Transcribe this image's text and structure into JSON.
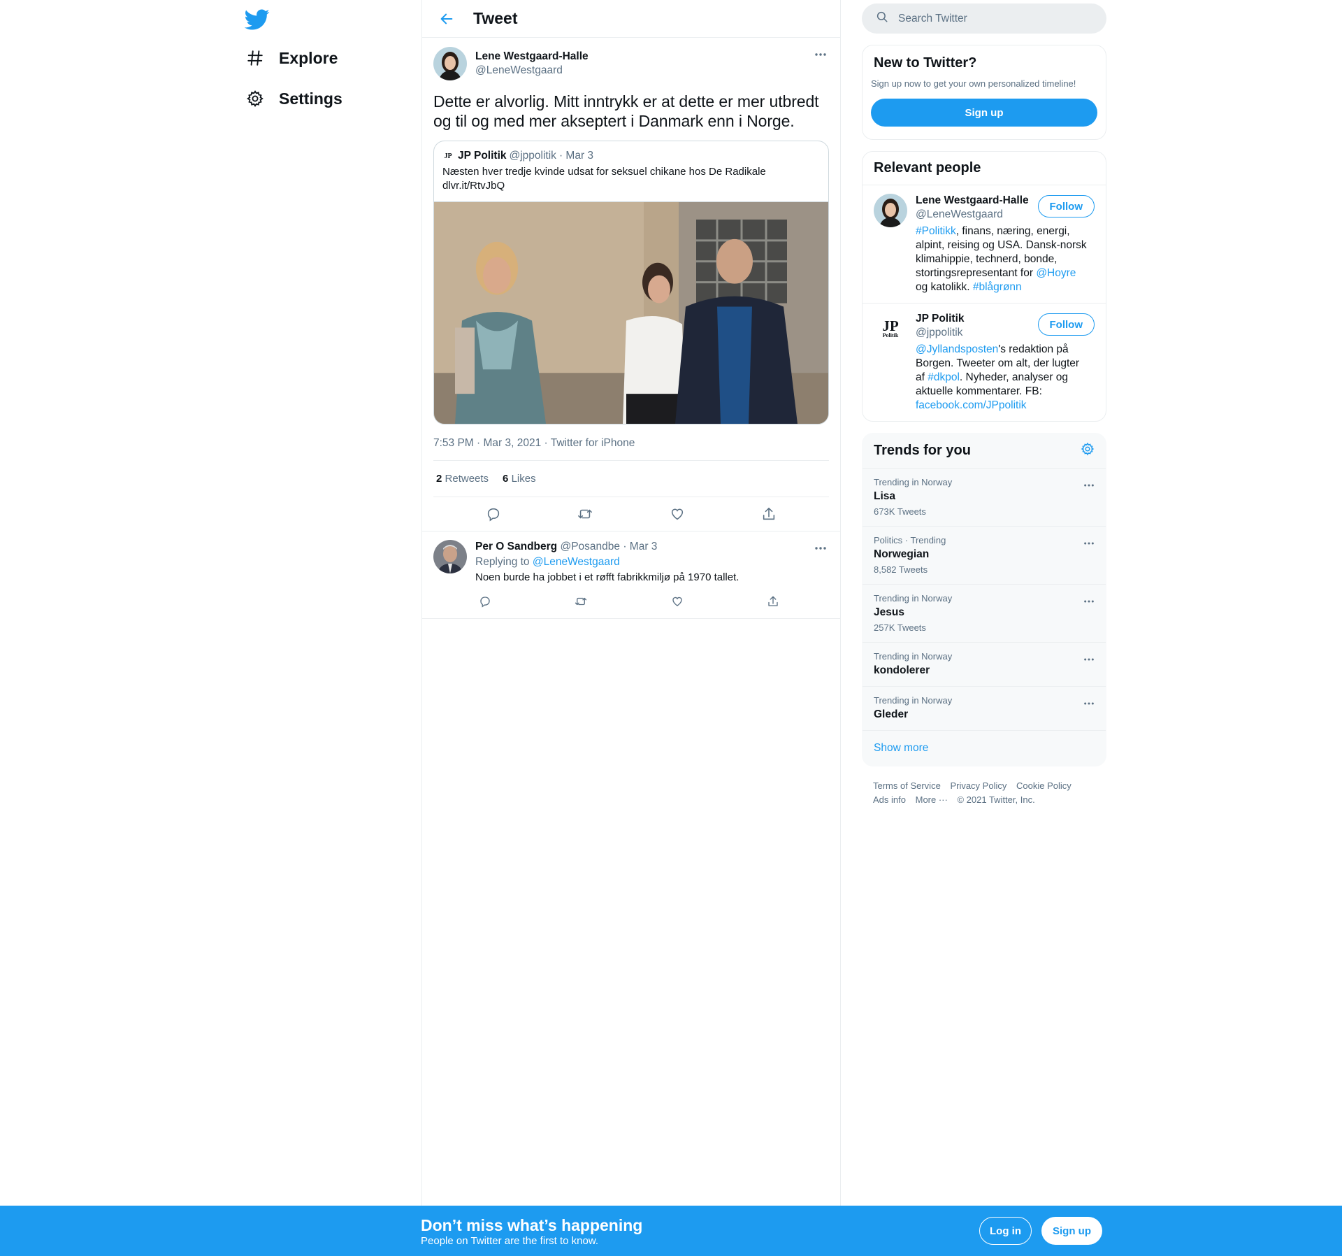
{
  "colors": {
    "accent": "#1d9bf0",
    "text": "#0f1419",
    "muted": "#5b7083",
    "border": "#ebeef0"
  },
  "nav": {
    "logo_icon": "twitter-bird-icon",
    "items": [
      {
        "label": "Explore",
        "icon": "hashtag-icon"
      },
      {
        "label": "Settings",
        "icon": "gear-icon"
      }
    ]
  },
  "header": {
    "title": "Tweet",
    "back_icon": "arrow-left-icon"
  },
  "tweet": {
    "author_name": "Lene Westgaard-Halle",
    "author_handle": "@LeneWestgaard",
    "text": "Dette er alvorlig. Mitt inntrykk er at dette er mer utbredt og til og med mer akseptert i Danmark enn i Norge.",
    "quote": {
      "logo_text": "JP",
      "name": "JP Politik",
      "handle": "@jppolitik",
      "date": "· Mar 3",
      "text_line1": "Næsten hver tredje kvinde udsat for seksuel chikane hos De Radikale",
      "text_line2": "dlvr.it/RtvJbQ"
    },
    "timestamp": "7:53 PM · Mar 3, 2021 · Twitter for iPhone",
    "retweets_count": "2",
    "retweets_label": "Retweets",
    "likes_count": "6",
    "likes_label": "Likes"
  },
  "reply": {
    "author_name": "Per O Sandberg",
    "author_handle": "@Posandbe",
    "date": "· Mar 3",
    "replying_prefix": "Replying to",
    "replying_to": "@LeneWestgaard",
    "text": "Noen burde ha jobbet i et røfft fabrikkmiljø på 1970 tallet."
  },
  "search": {
    "placeholder": "Search Twitter"
  },
  "new_to_twitter": {
    "title": "New to Twitter?",
    "subtitle": "Sign up now to get your own personalized timeline!",
    "button": "Sign up"
  },
  "relevant_people": {
    "title": "Relevant people",
    "follow_label": "Follow",
    "people": [
      {
        "name": "Lene Westgaard-Halle",
        "handle": "@LeneWestgaard",
        "bio_parts": [
          "#Politikk",
          ", finans, næring, energi, alpint, reising og USA. Dansk-norsk klimahippie, technerd, bonde, stortingsrepresentant for ",
          "@Hoyre",
          " og katolikk. ",
          "#blågrønn"
        ]
      },
      {
        "name": "JP Politik",
        "handle": "@jppolitik",
        "logo_top": "JP",
        "logo_bottom": "Politik",
        "bio_parts": [
          "@Jyllandsposten",
          "'s redaktion på Borgen. Tweeter om alt, der lugter af ",
          "#dkpol",
          ". Nyheder, analyser og aktuelle kommentarer. FB: ",
          "facebook.com/JPpolitik"
        ]
      }
    ]
  },
  "trends": {
    "title": "Trends for you",
    "items": [
      {
        "meta": "Trending in Norway",
        "name": "Lisa",
        "count": "673K Tweets"
      },
      {
        "meta": "Politics · Trending",
        "name": "Norwegian",
        "count": "8,582 Tweets"
      },
      {
        "meta": "Trending in Norway",
        "name": "Jesus",
        "count": "257K Tweets"
      },
      {
        "meta": "Trending in Norway",
        "name": "kondolerer",
        "count": ""
      },
      {
        "meta": "Trending in Norway",
        "name": "Gleder",
        "count": ""
      }
    ],
    "show_more": "Show more"
  },
  "footer": {
    "terms": "Terms of Service",
    "privacy": "Privacy Policy",
    "cookie": "Cookie Policy",
    "ads": "Ads info",
    "more": "More ···",
    "copyright": "© 2021 Twitter, Inc."
  },
  "bottom_bar": {
    "title": "Don’t miss what’s happening",
    "subtitle": "People on Twitter are the first to know.",
    "login": "Log in",
    "signup": "Sign up"
  }
}
